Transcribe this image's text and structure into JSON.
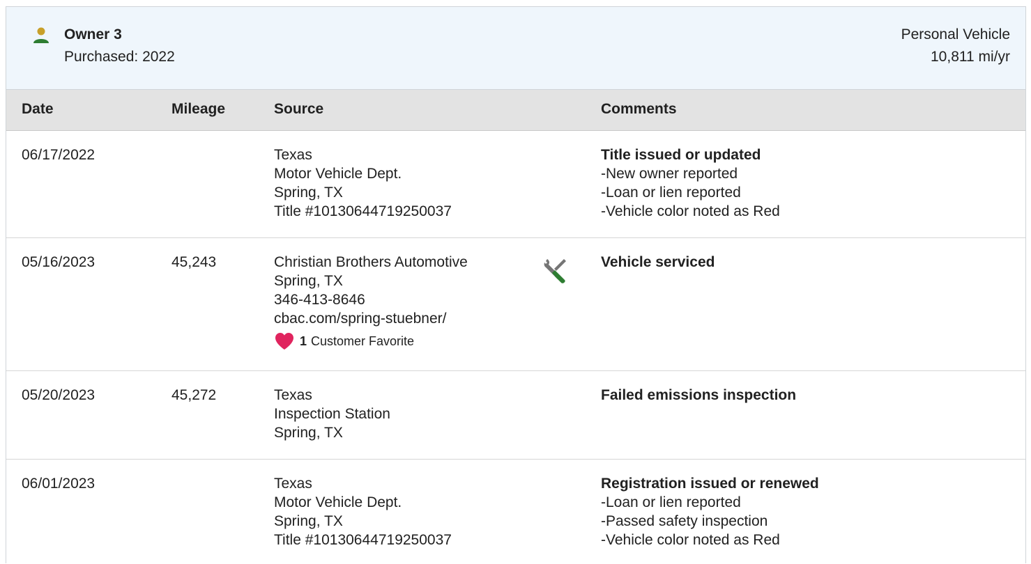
{
  "owner": {
    "title": "Owner 3",
    "purchased": "Purchased: 2022",
    "vehicle_type": "Personal Vehicle",
    "mileage_per_year": "10,811 mi/yr",
    "icon": "person-icon",
    "icon_color": "#2e7d32",
    "icon_head_color": "#c8a02a"
  },
  "table": {
    "headers": {
      "date": "Date",
      "mileage": "Mileage",
      "source": "Source",
      "comments": "Comments"
    },
    "rows": [
      {
        "date": "06/17/2022",
        "mileage": "",
        "source": [
          "Texas",
          "Motor Vehicle Dept.",
          "Spring, TX",
          "Title #10130644719250037"
        ],
        "comment_title": "Title issued or updated",
        "comment_items": [
          "New owner reported",
          "Loan or lien reported",
          "Vehicle color noted as Red"
        ]
      },
      {
        "date": "05/16/2023",
        "mileage": "45,243",
        "source": [
          "Christian Brothers Automotive",
          "Spring, TX",
          "346-413-8646",
          "cbac.com/spring-stuebner/"
        ],
        "favorite_count": "1",
        "favorite_label": "Customer Favorite",
        "service_icon": "wrench-screwdriver-icon",
        "comment_title": "Vehicle serviced",
        "comment_items": []
      },
      {
        "date": "05/20/2023",
        "mileage": "45,272",
        "source": [
          "Texas",
          "Inspection Station",
          "Spring, TX"
        ],
        "comment_title": "Failed emissions inspection",
        "comment_items": []
      },
      {
        "date": "06/01/2023",
        "mileage": "",
        "source": [
          "Texas",
          "Motor Vehicle Dept.",
          "Spring, TX",
          "Title #10130644719250037"
        ],
        "comment_title": "Registration issued or renewed",
        "comment_items": [
          "Loan or lien reported",
          "Passed safety inspection",
          "Vehicle color noted as Red"
        ]
      }
    ]
  },
  "colors": {
    "header_bg": "#eff6fc",
    "table_head_bg": "#e3e3e3",
    "heart": "#e0245e",
    "tool_gray": "#757575",
    "tool_green": "#2e7d32"
  }
}
